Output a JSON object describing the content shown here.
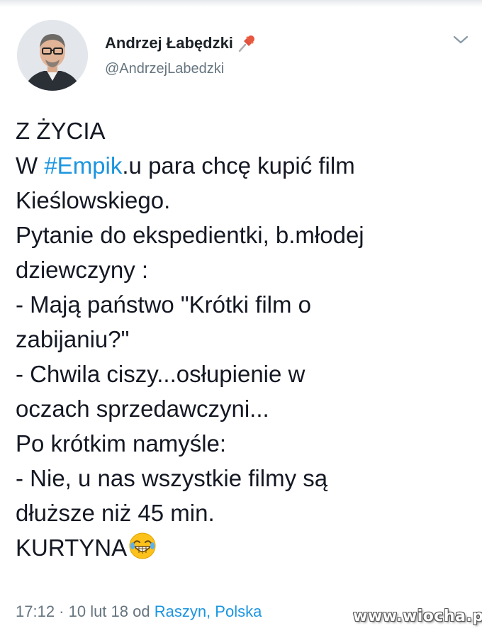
{
  "author": {
    "name": "Andrzej Łabędzki",
    "handle": "@AndrzejLabedzki",
    "pin_icon": "pushpin-icon",
    "avatar": "profile-photo"
  },
  "menu_icon": "chevron-down-icon",
  "tweet": {
    "lines": [
      {
        "text": "Z ŻYCIA"
      },
      {
        "pre": "W ",
        "hashtag": "#Empik",
        "post": ".u para chcę kupić film"
      },
      {
        "text": "Kieślowskiego."
      },
      {
        "text": "Pytanie do ekspedientki, b.młodej"
      },
      {
        "text": "dziewczyny :"
      },
      {
        "text": "- Mają państwo \"Krótki film o"
      },
      {
        "text": "zabijaniu?\""
      },
      {
        "text": "- Chwila ciszy...osłupienie w"
      },
      {
        "text": "oczach sprzedawczyni..."
      },
      {
        "text": "Po krótkim namyśle:"
      },
      {
        "text": "- Nie, u nas wszystkie filmy są"
      },
      {
        "text": "dłuższe niż 45 min."
      },
      {
        "text": "KURTYNA",
        "emoji": "laughing-face-emoji"
      }
    ]
  },
  "meta": {
    "time_date": "17:12 · 10 lut 18 od ",
    "place": "Raszyn, Polska"
  },
  "watermark": "www.wiocha.pl",
  "colors": {
    "link": "#1b95e0",
    "secondary_text": "#66757f",
    "primary_text": "#141823"
  }
}
